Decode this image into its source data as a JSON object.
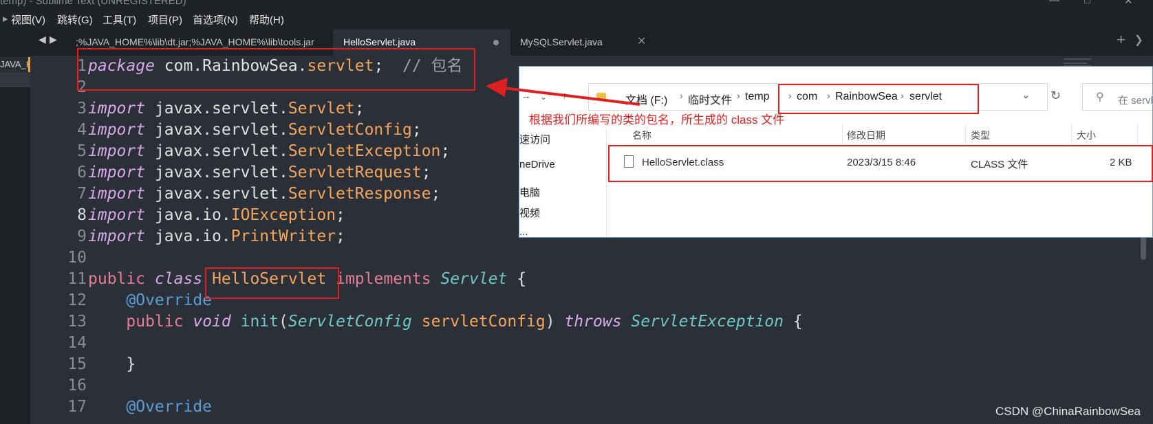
{
  "window": {
    "title": "temp) - Sublime Text (UNREGISTERED)",
    "controls": [
      "minimize-icon",
      "maximize-icon",
      "close-icon"
    ]
  },
  "menu": {
    "items": [
      "视图(V)",
      "跳转(G)",
      "工具(T)",
      "项目(P)",
      "首选项(N)",
      "帮助(H)"
    ]
  },
  "sidebar": {
    "item_label": "JAVA_HO"
  },
  "tabs": [
    {
      "label": ";%JAVA_HOME%\\lib\\dt.jar;%JAVA_HOME%\\lib\\tools.jar",
      "active": false,
      "dirty": true
    },
    {
      "label": "HelloServlet.java",
      "active": true,
      "dirty": true
    },
    {
      "label": "MySQLServlet.java",
      "active": false,
      "dirty": false
    }
  ],
  "tabbar": {
    "plus": "+",
    "chevron": "❯"
  },
  "editor": {
    "current_line": 8,
    "line_numbers": [
      "1",
      "2",
      "3",
      "4",
      "5",
      "6",
      "7",
      "8",
      "9",
      "10",
      "11",
      "12",
      "13",
      "14",
      "15",
      "16",
      "17"
    ],
    "lines": [
      [
        [
          "kw-i",
          "package"
        ],
        [
          "plain",
          " com.RainbowSea."
        ],
        [
          "cls",
          "servlet"
        ],
        [
          "plain",
          ";  "
        ],
        [
          "cm",
          "// 包名"
        ]
      ],
      [],
      [
        [
          "kw-i",
          "import"
        ],
        [
          "plain",
          " javax.servlet."
        ],
        [
          "cls",
          "Servlet"
        ],
        [
          "plain",
          ";"
        ]
      ],
      [
        [
          "kw-i",
          "import"
        ],
        [
          "plain",
          " javax.servlet."
        ],
        [
          "cls",
          "ServletConfig"
        ],
        [
          "plain",
          ";"
        ]
      ],
      [
        [
          "kw-i",
          "import"
        ],
        [
          "plain",
          " javax.servlet."
        ],
        [
          "cls",
          "ServletException"
        ],
        [
          "plain",
          ";"
        ]
      ],
      [
        [
          "kw-i",
          "import"
        ],
        [
          "plain",
          " javax.servlet."
        ],
        [
          "cls",
          "ServletRequest"
        ],
        [
          "plain",
          ";"
        ]
      ],
      [
        [
          "kw-i",
          "import"
        ],
        [
          "plain",
          " javax.servlet."
        ],
        [
          "cls",
          "ServletResponse"
        ],
        [
          "plain",
          ";"
        ]
      ],
      [
        [
          "kw-i",
          "import"
        ],
        [
          "plain",
          " java.io."
        ],
        [
          "cls",
          "IOException"
        ],
        [
          "plain",
          ";"
        ]
      ],
      [
        [
          "kw-i",
          "import"
        ],
        [
          "plain",
          " java.io."
        ],
        [
          "cls",
          "PrintWriter"
        ],
        [
          "plain",
          ";"
        ]
      ],
      [],
      [
        [
          "kw",
          "public"
        ],
        [
          "plain",
          " "
        ],
        [
          "kw-i",
          "class"
        ],
        [
          "plain",
          " "
        ],
        [
          "cls",
          "HelloServlet"
        ],
        [
          "plain",
          " "
        ],
        [
          "kw",
          "implements"
        ],
        [
          "plain",
          " "
        ],
        [
          "typ",
          "Servlet"
        ],
        [
          "plain",
          " {"
        ]
      ],
      [
        [
          "plain",
          "    "
        ],
        [
          "ann",
          "@Override"
        ]
      ],
      [
        [
          "plain",
          "    "
        ],
        [
          "kw",
          "public"
        ],
        [
          "plain",
          " "
        ],
        [
          "kw-i",
          "void"
        ],
        [
          "plain",
          " "
        ],
        [
          "fn",
          "init"
        ],
        [
          "par",
          "("
        ],
        [
          "typ",
          "ServletConfig"
        ],
        [
          "plain",
          " "
        ],
        [
          "cls",
          "servletConfig"
        ],
        [
          "par",
          ")"
        ],
        [
          "plain",
          " "
        ],
        [
          "kw-i",
          "throws"
        ],
        [
          "plain",
          " "
        ],
        [
          "typ",
          "ServletException"
        ],
        [
          "plain",
          " {"
        ]
      ],
      [],
      [
        [
          "plain",
          "    }"
        ]
      ],
      [],
      [
        [
          "plain",
          "    "
        ],
        [
          "ann",
          "@Override"
        ]
      ]
    ]
  },
  "explorer": {
    "breadcrumb": [
      "文档 (F:)",
      "临时文件",
      "temp",
      "com",
      "RainbowSea",
      "servlet"
    ],
    "search_placeholder": "在 servl",
    "nav_items": [
      "速访问",
      "neDrive",
      "电脑",
      "视频",
      "..."
    ],
    "columns": [
      "名称",
      "修改日期",
      "类型",
      "大小"
    ],
    "file": {
      "name": "HelloServlet.class",
      "modified": "2023/3/15 8:46",
      "type": "CLASS 文件",
      "size": "2 KB"
    }
  },
  "annotation": {
    "text": "根据我们所编写的类的包名，所生成的 class 文件",
    "color": "#e02020"
  },
  "watermark": "CSDN @ChinaRainbowSea",
  "colors": {
    "editor_bg": "#2b3038",
    "keyword": "#e87a95",
    "keyword_italic": "#d7a8e8",
    "class_name": "#f5a55a",
    "type_italic": "#6fc7c3",
    "annotation": "#5c9dd6",
    "highlight_box": "#e02020"
  }
}
